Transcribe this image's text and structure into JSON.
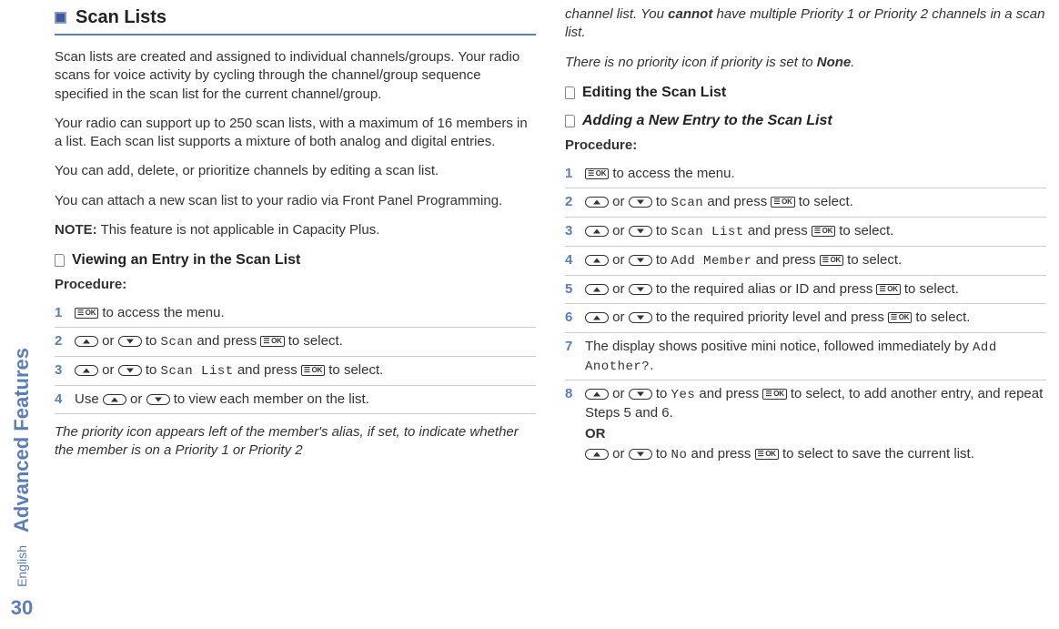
{
  "sidebar": {
    "label": "Advanced Features",
    "page": "30"
  },
  "english_label": "English",
  "section": {
    "title": "Scan Lists",
    "p1": "Scan lists are created and assigned to individual channels/groups. Your radio scans for voice activity by cycling through the channel/group sequence specified in the scan list for the current channel/group.",
    "p2": "Your radio can support up to 250 scan lists, with a maximum of 16 members in a list. Each scan list supports a mixture of both analog and digital entries.",
    "p3": "You can add, delete, or prioritize channels by editing a scan list.",
    "p4": "You can attach a new scan list to your radio via Front Panel Programming.",
    "note_label": "NOTE:",
    "note_body": "This feature is not applicable in Capacity Plus."
  },
  "proc_label": "Procedure:",
  "viewing": {
    "title": "Viewing an Entry in the Scan List",
    "s1": " to access the menu.",
    "s2_a": " or ",
    "s2_b": " to ",
    "s2_c": "Scan",
    "s2_d": " and press ",
    "s2_e": " to select.",
    "s3_a": " or ",
    "s3_b": " to ",
    "s3_c": "Scan List",
    "s3_d": " and press ",
    "s3_e": " to select.",
    "s4_a": "Use ",
    "s4_b": " or ",
    "s4_c": " to view each member on the list.",
    "footer": "The priority icon appears left of the member's alias, if set, to indicate whether the member is on a Priority 1 or Priority 2 "
  },
  "col2": {
    "cont1_a": "channel list. You ",
    "cont1_b": "cannot",
    "cont1_c": " have multiple Priority 1 or Priority 2 channels in a scan list.",
    "cont2_a": "There is no priority icon if priority is set to ",
    "cont2_b": "None",
    "cont2_c": ".",
    "edit_title": "Editing the Scan List",
    "add_title": "Adding a New Entry to the Scan List"
  },
  "adding": {
    "s1": " to access the menu.",
    "s2": {
      "or": " or ",
      "to": " to ",
      "val": "Scan",
      "press": " and press ",
      "sel": " to select."
    },
    "s3": {
      "or": " or ",
      "to": " to ",
      "val": "Scan List",
      "press": " and press ",
      "sel": " to select."
    },
    "s4": {
      "or": " or ",
      "to": " to ",
      "val": "Add Member",
      "press": " and press ",
      "sel": " to select."
    },
    "s5": {
      "or": " or ",
      "to": " to the required alias or ID and press ",
      "sel": " to select."
    },
    "s6": {
      "or": " or ",
      "to": " to the required priority level and press ",
      "sel": " to select."
    },
    "s7_a": "The display shows positive mini notice, followed immediately by ",
    "s7_b": "Add Another?",
    "s7_c": ".",
    "s8": {
      "or": " or ",
      "to": " to ",
      "yes": "Yes",
      "press": " and press ",
      "sel1": " to select, to add another entry, and repeat Steps 5 and 6.",
      "OR": "OR",
      "no": "No",
      "sel2": " to select to save the current list."
    }
  },
  "nums": {
    "1": "1",
    "2": "2",
    "3": "3",
    "4": "4",
    "5": "5",
    "6": "6",
    "7": "7",
    "8": "8"
  },
  "keys": {
    "ok": "☰ OK"
  }
}
